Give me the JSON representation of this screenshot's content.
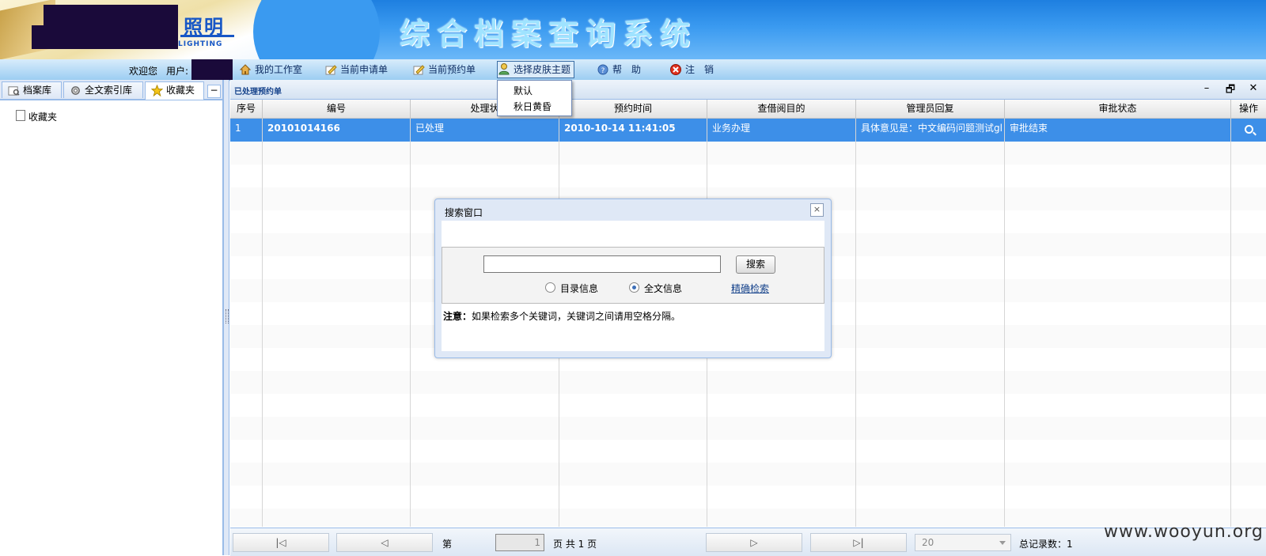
{
  "header": {
    "logo_cn": "照明",
    "logo_en": "LIGHTING",
    "system_title": "综合档案查询系统"
  },
  "toolbar": {
    "welcome": "欢迎您",
    "user_label": "用户:",
    "items": [
      {
        "label": "我的工作室",
        "icon": "home-icon"
      },
      {
        "label": "当前申请单",
        "icon": "edit-icon"
      },
      {
        "label": "当前预约单",
        "icon": "edit-icon"
      },
      {
        "label": "选择皮肤主题",
        "icon": "user-icon"
      },
      {
        "label": "帮　助",
        "icon": "help-icon"
      },
      {
        "label": "注　销",
        "icon": "logout-icon"
      }
    ]
  },
  "skin_menu": {
    "options": [
      "默认",
      "秋日黄昏"
    ]
  },
  "left_panel": {
    "tabs": [
      {
        "label": "档案库",
        "icon": "archive-icon"
      },
      {
        "label": "全文索引库",
        "icon": "gear-icon"
      },
      {
        "label": "收藏夹",
        "icon": "star-icon"
      }
    ],
    "collapse": "−",
    "tree": [
      {
        "label": "收藏夹",
        "icon": "document-icon"
      }
    ]
  },
  "main_panel": {
    "title": "已处理预约单",
    "controls": {
      "minimize": "–",
      "restore": "🗗",
      "close": "✕"
    },
    "columns": [
      "序号",
      "编号",
      "处理状",
      "预约时间",
      "查借阅目的",
      "管理员回复",
      "审批状态",
      "操作"
    ],
    "rows": [
      {
        "index": "1",
        "number": "20101014166",
        "status": "已处理",
        "time": "2010-10-14 11:41:05",
        "purpose": "业务办理",
        "reply": "具体意见是：中文编码问题测试gl",
        "approval": "审批结束",
        "action_icon": "search-icon"
      }
    ]
  },
  "pager": {
    "first": "|◁",
    "prev": "◁",
    "page_prefix": "第",
    "page_value": "1",
    "page_suffix": "页 共 1 页",
    "next": "▷",
    "last": "▷|",
    "page_size": "20",
    "total_label": "总记录数：",
    "total_value": "1"
  },
  "search_window": {
    "title": "搜索窗口",
    "close": "×",
    "input_value": "",
    "search_button": "搜索",
    "radio_catalog": "目录信息",
    "radio_fulltext": "全文信息",
    "selected": "fulltext",
    "advanced_link": "精确检索",
    "note_label": "注意：",
    "note_text": "如果检索多个关键词，关键词之间请用空格分隔。"
  },
  "watermark": "www.wooyun.org"
}
